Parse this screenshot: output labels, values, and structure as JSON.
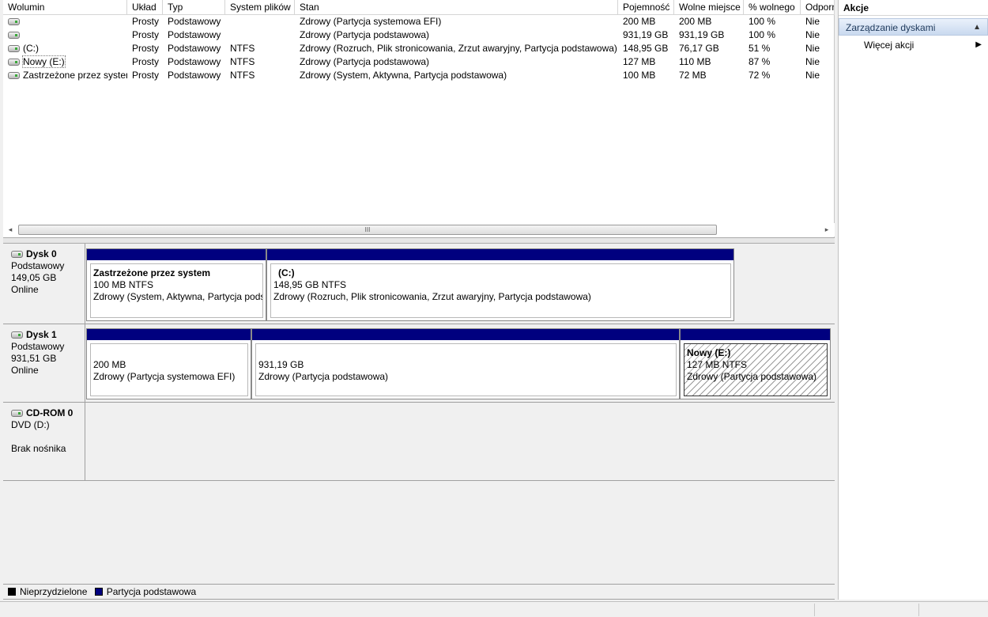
{
  "volume_table": {
    "columns": [
      "Wolumin",
      "Układ",
      "Typ",
      "System plików",
      "Stan",
      "Pojemność",
      "Wolne miejsce",
      "% wolnego",
      "Odporn"
    ],
    "rows": [
      {
        "name": "",
        "layout": "Prosty",
        "type": "Podstawowy",
        "fs": "",
        "status": "Zdrowy (Partycja systemowa EFI)",
        "capacity": "200 MB",
        "free": "200 MB",
        "pct": "100 %",
        "fault": "Nie"
      },
      {
        "name": "",
        "layout": "Prosty",
        "type": "Podstawowy",
        "fs": "",
        "status": "Zdrowy (Partycja podstawowa)",
        "capacity": "931,19 GB",
        "free": "931,19 GB",
        "pct": "100 %",
        "fault": "Nie"
      },
      {
        "name": "(C:)",
        "layout": "Prosty",
        "type": "Podstawowy",
        "fs": "NTFS",
        "status": "Zdrowy (Rozruch, Plik stronicowania, Zrzut awaryjny, Partycja podstawowa)",
        "capacity": "148,95 GB",
        "free": "76,17 GB",
        "pct": "51 %",
        "fault": "Nie"
      },
      {
        "name": "Nowy (E:)",
        "layout": "Prosty",
        "type": "Podstawowy",
        "fs": "NTFS",
        "status": "Zdrowy (Partycja podstawowa)",
        "capacity": "127 MB",
        "free": "110 MB",
        "pct": "87 %",
        "fault": "Nie"
      },
      {
        "name": "Zastrzeżone przez system",
        "layout": "Prosty",
        "type": "Podstawowy",
        "fs": "NTFS",
        "status": "Zdrowy (System, Aktywna, Partycja podstawowa)",
        "capacity": "100 MB",
        "free": "72 MB",
        "pct": "72 %",
        "fault": "Nie"
      }
    ]
  },
  "scrollbar": {
    "grip": "III",
    "left_arrow": "◂",
    "right_arrow": "▸"
  },
  "disks": [
    {
      "name": "Dysk 0",
      "type": "Podstawowy",
      "size": "149,05 GB",
      "state": "Online",
      "partitions": [
        {
          "title": "Zastrzeżone przez system",
          "size": "100 MB NTFS",
          "status": "Zdrowy (System, Aktywna, Partycja podstawowa)"
        },
        {
          "title": "(C:)",
          "size": "148,95 GB NTFS",
          "status": "Zdrowy (Rozruch, Plik stronicowania, Zrzut awaryjny, Partycja podstawowa)"
        }
      ]
    },
    {
      "name": "Dysk 1",
      "type": "Podstawowy",
      "size": "931,51 GB",
      "state": "Online",
      "partitions": [
        {
          "title": "",
          "size": "200 MB",
          "status": "Zdrowy (Partycja systemowa EFI)"
        },
        {
          "title": "",
          "size": "931,19 GB",
          "status": "Zdrowy (Partycja podstawowa)"
        },
        {
          "title": "Nowy  (E:)",
          "size": "127 MB NTFS",
          "status": "Zdrowy (Partycja podstawowa)"
        }
      ]
    }
  ],
  "cdrom": {
    "name": "CD-ROM 0",
    "drive": "DVD (D:)",
    "media": "Brak nośnika"
  },
  "legend": [
    {
      "label": "Nieprzydzielone",
      "color": "#000000"
    },
    {
      "label": "Partycja podstawowa",
      "color": "#00007f"
    }
  ],
  "actions": {
    "title": "Akcje",
    "section": "Zarządzanie dyskami",
    "section_icon": "collapse-up-icon",
    "more": "Więcej akcji",
    "more_icon": "submenu-arrow-icon"
  },
  "colors": {
    "partition_bar": "#00007f",
    "selected_section": "#c9d9ef"
  }
}
